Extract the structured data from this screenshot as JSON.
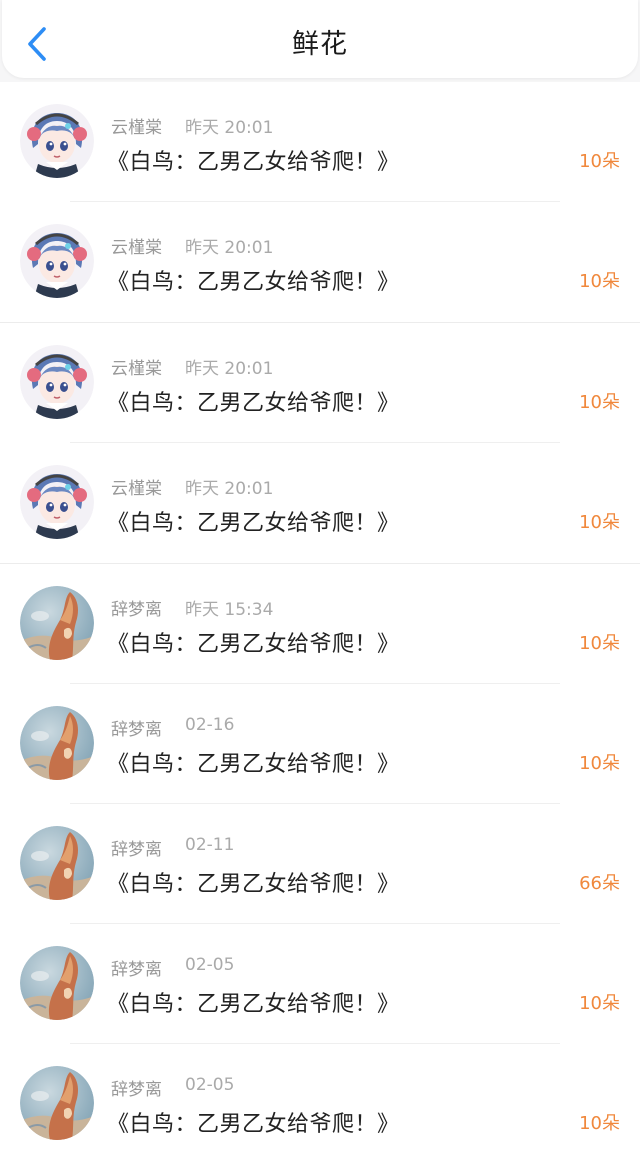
{
  "header": {
    "title": "鲜花",
    "back_icon": "chevron-left-icon",
    "accent": "#2d8df5"
  },
  "colors": {
    "count": "#f0883c",
    "name": "#999999",
    "text": "#222222"
  },
  "items": [
    {
      "name": "云槿棠",
      "time": "昨天 20:01",
      "book": "《白鸟：乙男乙女给爷爬！》",
      "count": "10朵",
      "avatar": "anime-girl-avatar"
    },
    {
      "name": "云槿棠",
      "time": "昨天 20:01",
      "book": "《白鸟：乙男乙女给爷爬！》",
      "count": "10朵",
      "avatar": "anime-girl-avatar"
    },
    {
      "name": "云槿棠",
      "time": "昨天 20:01",
      "book": "《白鸟：乙男乙女给爷爬！》",
      "count": "10朵",
      "avatar": "anime-girl-avatar"
    },
    {
      "name": "云槿棠",
      "time": "昨天 20:01",
      "book": "《白鸟：乙男乙女给爷爬！》",
      "count": "10朵",
      "avatar": "anime-girl-avatar"
    },
    {
      "name": "辞梦离",
      "time": "昨天 15:34",
      "book": "《白鸟：乙男乙女给爷爬！》",
      "count": "10朵",
      "avatar": "painting-avatar"
    },
    {
      "name": "辞梦离",
      "time": "02-16",
      "book": "《白鸟：乙男乙女给爷爬！》",
      "count": "10朵",
      "avatar": "painting-avatar"
    },
    {
      "name": "辞梦离",
      "time": "02-11",
      "book": "《白鸟：乙男乙女给爷爬！》",
      "count": "66朵",
      "avatar": "painting-avatar"
    },
    {
      "name": "辞梦离",
      "time": "02-05",
      "book": "《白鸟：乙男乙女给爷爬！》",
      "count": "10朵",
      "avatar": "painting-avatar"
    },
    {
      "name": "辞梦离",
      "time": "02-05",
      "book": "《白鸟：乙男乙女给爷爬！》",
      "count": "10朵",
      "avatar": "painting-avatar"
    }
  ]
}
